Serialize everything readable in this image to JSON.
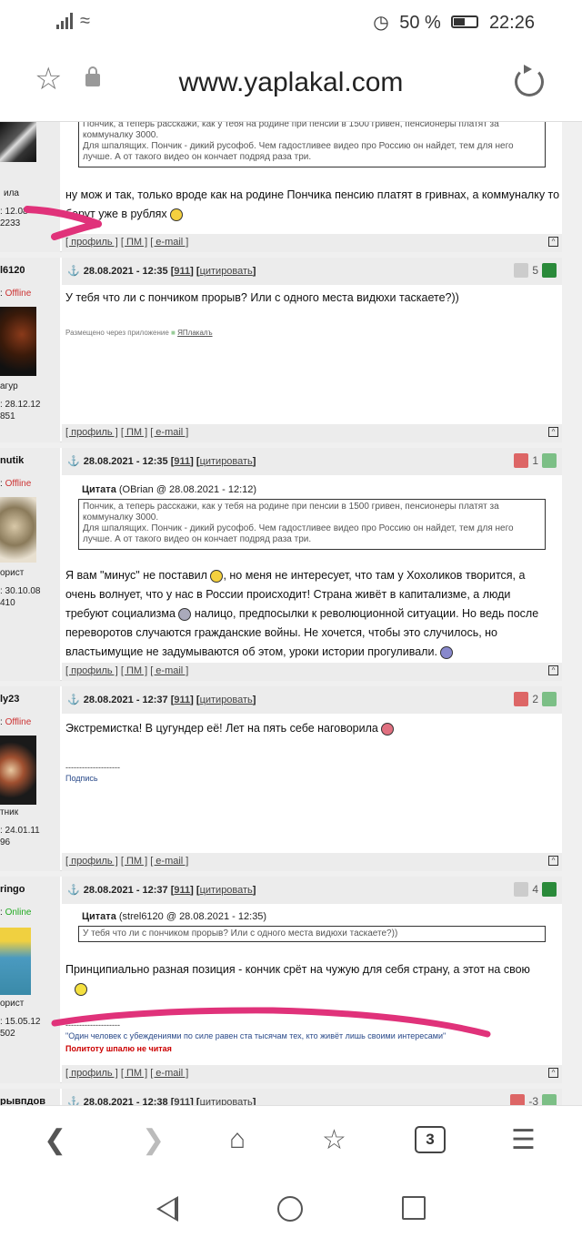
{
  "status_bar": {
    "battery": "50 %",
    "time": "22:26"
  },
  "browser": {
    "url": "www.yaplakal.com",
    "tabs_count": "3"
  },
  "footer_links": {
    "profile": "[ профиль ]",
    "pm": "[ ПМ ]",
    "email": "[ e-mail ]",
    "top": "^"
  },
  "post0": {
    "user_fragment": "ила",
    "reg_fragment": ": 12.08",
    "posts_fragment": "2233",
    "quote": "Пончик, а теперь расскажи, как у тебя на родине при пенсии в 1500 гривен, пенсионеры платят за коммуналку 3000.\nДля шпалящих. Пончик - дикий русофоб. Чем гадостливее видео про Россию он найдет, тем для него лучше. А от такого видео он кончает подряд раза три.",
    "text": "ну мож и так, только вроде как на родине Пончика пенсию платят в гривнах, а коммуналку то берут уже в рублях"
  },
  "post1": {
    "username": "l6120",
    "status_prefix": ": ",
    "status": "Offline",
    "rank": "агур",
    "reg": ": 28.12.12",
    "posts": "851",
    "date": "28.08.2021 - 12:35",
    "n911": "911",
    "cite": "цитировать",
    "rating": "5",
    "text": "У тебя что ли с пончиком прорыв? Или с одного места видюхи таскаете?))",
    "via": "Размещено через приложение",
    "app": "ЯПлакалъ"
  },
  "post2": {
    "username": "nutik",
    "status_prefix": ": ",
    "status": "Offline",
    "rank": "орист",
    "reg": ": 30.10.08",
    "posts": "410",
    "date": "28.08.2021 - 12:35",
    "n911": "911",
    "cite": "цитировать",
    "rating": "1",
    "quote_label": "Цитата",
    "quote_author": "(OBrian @ 28.08.2021 - 12:12)",
    "quote": "Пончик, а теперь расскажи, как у тебя на родине при пенсии в 1500 гривен, пенсионеры платят за коммуналку 3000.\nДля шпалящих. Пончик - дикий русофоб. Чем гадостливее видео про Россию он найдет, тем для него лучше. А от такого видео он кончает подряд раза три.",
    "text1": "Я вам \"минус\" не поставил",
    "text2": ", но меня не интересует, что там у Хохоликов творится, а очень волнует, что у нас в России происходит! Страна живёт в капитализме, а люди требуют социализма",
    "text3": " налицо, предпосылки к революционной ситуации. Но ведь после переворотов случаются гражданские войны. Не хочется, чтобы это случилось, но властьимущие не задумываются об этом, уроки истории прогуливали."
  },
  "post3": {
    "username": "ly23",
    "status_prefix": ": ",
    "status": "Offline",
    "rank": "тник",
    "reg": ": 24.01.11",
    "posts": "96",
    "date": "28.08.2021 - 12:37",
    "n911": "911",
    "cite": "цитировать",
    "rating": "2",
    "text": "Экстремистка! В цугундер её! Лет на пять себе наговорила",
    "sig_line": "--------------------",
    "sig": "Подпись"
  },
  "post4": {
    "username": "ringo",
    "status_prefix": ": ",
    "status": "Online",
    "rank": "орист",
    "reg": ": 15.05.12",
    "posts": "502",
    "date": "28.08.2021 - 12:37",
    "n911": "911",
    "cite": "цитировать",
    "rating": "4",
    "quote_label": "Цитата",
    "quote_author": "(strel6120 @ 28.08.2021 - 12:35)",
    "quote": "У тебя что ли с пончиком прорыв? Или с одного места видюхи таскаете?))",
    "text": "Принципиально разная позиция - кончик срёт на чужую для себя страну, а этот на свою",
    "sig_line": "--------------------",
    "sig": "\"Один человек с убеждениями по силе равен ста тысячам тех, кто живёт лишь своими интересами\"",
    "sig_red": "Политоту шпалю не читая"
  },
  "post5": {
    "username": "рывпдов",
    "date": "28.08.2021 - 12:38",
    "n911": "911",
    "cite": "цитировать",
    "rating": "-3"
  },
  "colors": {
    "marker": "#e0327a",
    "offline": "#cc3333",
    "online": "#22aa22",
    "n911": "#cc0000"
  }
}
